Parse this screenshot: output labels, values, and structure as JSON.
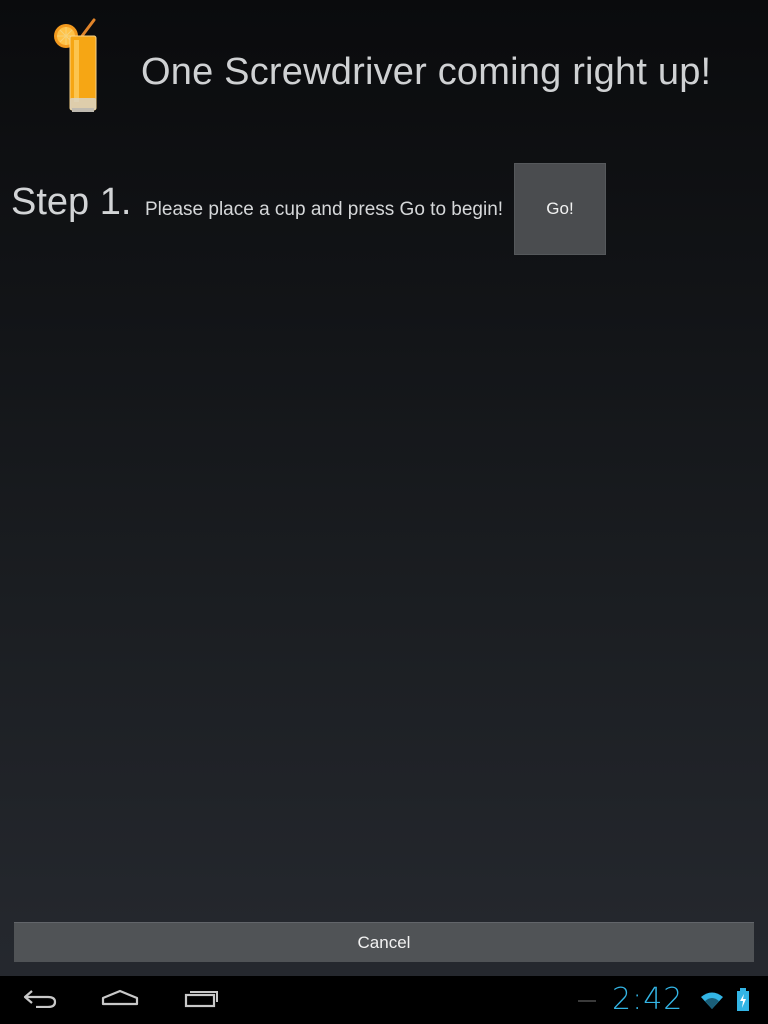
{
  "header": {
    "title": "One Screwdriver coming right up!",
    "icon": "screwdriver-drink-icon"
  },
  "step": {
    "label": "Step 1.",
    "instruction": "Please place a cup and press Go to begin!",
    "go_label": "Go!"
  },
  "footer": {
    "cancel_label": "Cancel"
  },
  "system_bar": {
    "clock": "2:42",
    "icons": [
      "back-icon",
      "home-icon",
      "recent-apps-icon",
      "wifi-icon",
      "battery-charging-icon"
    ],
    "accent_color": "#33b5e5"
  },
  "colors": {
    "button_bg": "#4a4c4f",
    "text": "#d2d4d6"
  }
}
